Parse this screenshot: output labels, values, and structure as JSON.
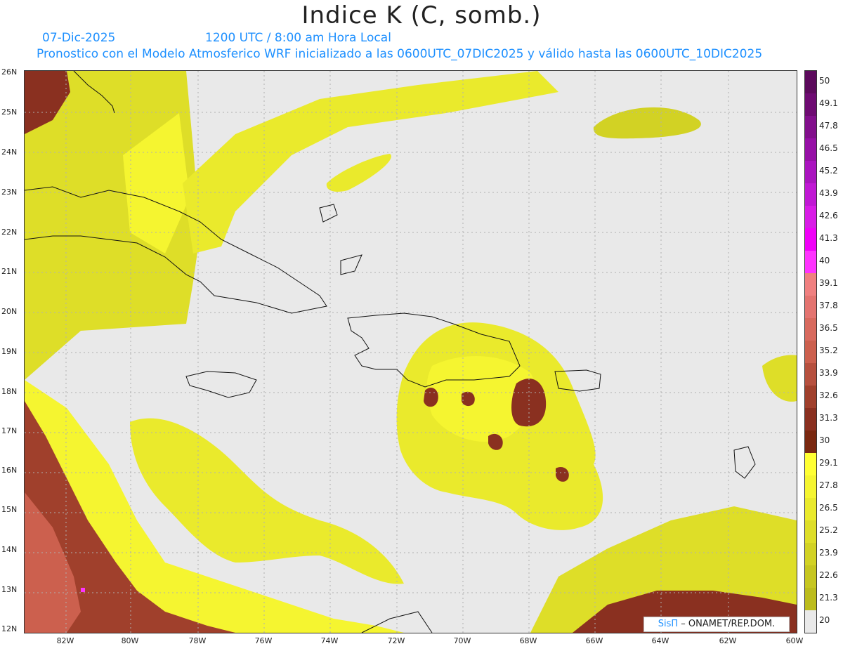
{
  "header": {
    "title": "Indice K (C, somb.)",
    "date": "07-Dic-2025",
    "time": "1200 UTC / 8:00 am Hora Local",
    "model_line": "Pronostico con el Modelo Atmosferico WRF inicializado a las 0600UTC_07DIC2025 y válido hasta las  0600UTC_10DIC2025"
  },
  "map": {
    "lat_labels": [
      "26N",
      "25N",
      "24N",
      "23N",
      "22N",
      "21N",
      "20N",
      "19N",
      "18N",
      "17N",
      "16N",
      "15N",
      "14N",
      "13N",
      "12N"
    ],
    "lon_labels": [
      "82W",
      "80W",
      "78W",
      "76W",
      "74W",
      "72W",
      "70W",
      "68W",
      "66W",
      "64W",
      "62W",
      "60W"
    ],
    "background_color": "#e9e9e9",
    "grid": "dotted"
  },
  "colorbar": {
    "labels": [
      "50",
      "49.1",
      "47.8",
      "46.5",
      "45.2",
      "43.9",
      "42.6",
      "41.3",
      "40",
      "39.1",
      "37.8",
      "36.5",
      "35.2",
      "33.9",
      "32.6",
      "31.3",
      "30",
      "29.1",
      "27.8",
      "26.5",
      "25.2",
      "23.9",
      "22.6",
      "21.3",
      "20"
    ],
    "colors": [
      "#5c0a5c",
      "#6e0b72",
      "#820f8c",
      "#9610a6",
      "#aa14bf",
      "#c018d4",
      "#d81ce6",
      "#f000f8",
      "#ff33ff",
      "#f08080",
      "#e47470",
      "#d86a5e",
      "#cc604e",
      "#b6503e",
      "#a0402c",
      "#8a3020",
      "#7a2810",
      "#ffff33",
      "#f5f530",
      "#eaea2c",
      "#dede28",
      "#d2d224",
      "#c6c620",
      "#bcbc1c",
      "#e9e9e9"
    ]
  },
  "credit": {
    "sis": "SisΠ",
    "text": " – ONAMET/REP.DOM."
  }
}
